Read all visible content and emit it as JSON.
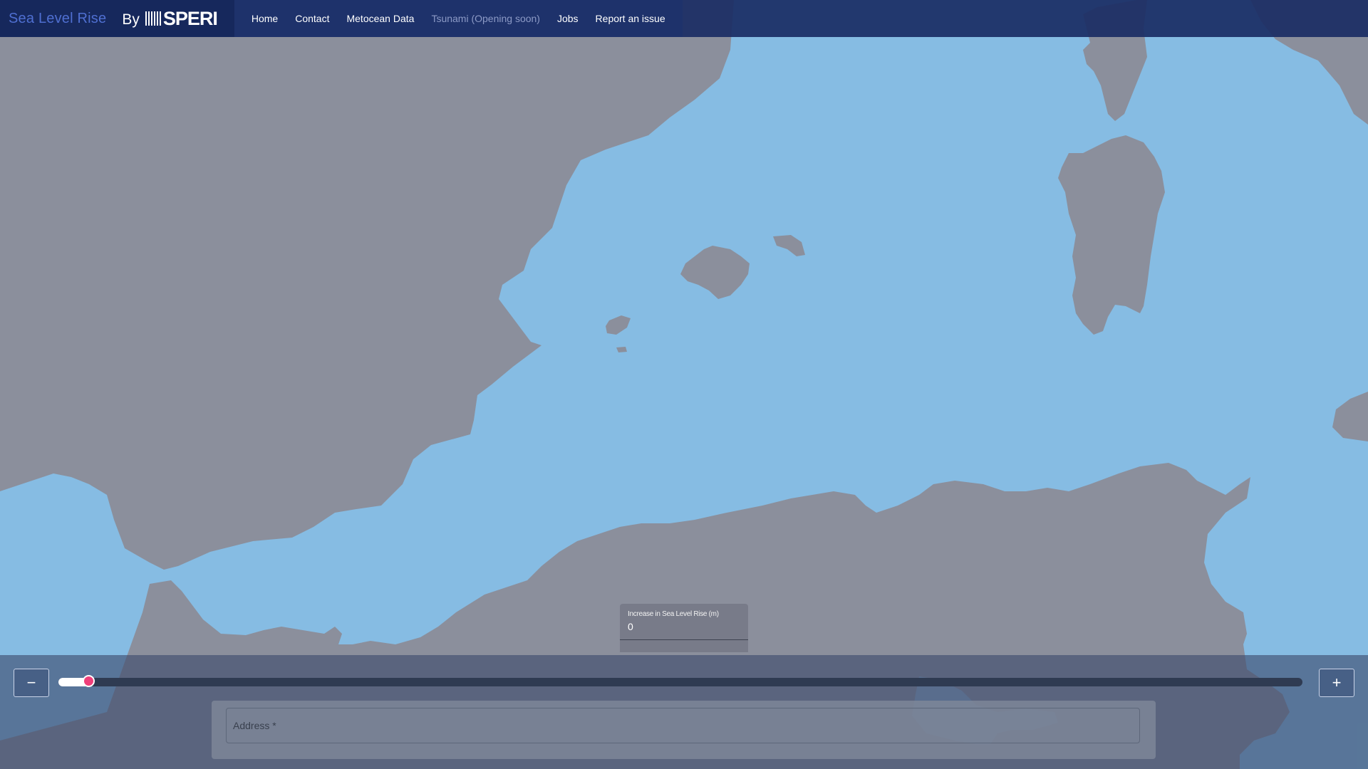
{
  "app": {
    "title": "Sea Level Rise",
    "by": "By",
    "logo_text": "SPERI"
  },
  "nav": {
    "items": [
      {
        "label": "Home",
        "enabled": true
      },
      {
        "label": "Contact",
        "enabled": true
      },
      {
        "label": "Metocean Data",
        "enabled": true
      },
      {
        "label": "Tsunami (Opening soon)",
        "enabled": false
      },
      {
        "label": "Jobs",
        "enabled": true
      },
      {
        "label": "Report an issue",
        "enabled": true
      }
    ]
  },
  "controls": {
    "decrease_label": "−",
    "increase_label": "+",
    "rise_label": "Increase in Sea Level Rise (m)",
    "rise_value": "0",
    "slider_position_fraction": 0.017
  },
  "search": {
    "placeholder": "Address *"
  },
  "colors": {
    "water": "#86bce3",
    "land": "#8b8f9c",
    "navbar": "#1f3373",
    "brand_title": "#4f6fd1",
    "slider_thumb": "#ef3f7a"
  }
}
